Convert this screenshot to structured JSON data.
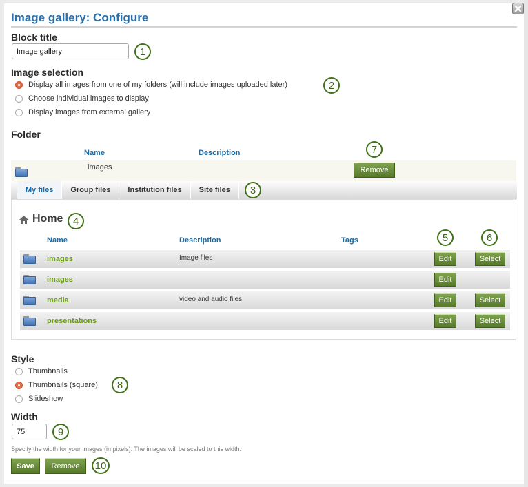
{
  "dialog": {
    "title": "Image gallery: Configure",
    "close_icon": "close-icon"
  },
  "block_title": {
    "label": "Block title",
    "value": "Image gallery"
  },
  "image_selection": {
    "label": "Image selection",
    "options": [
      {
        "label": "Display all images from one of my folders (will include images uploaded later)",
        "selected": true
      },
      {
        "label": "Choose individual images to display",
        "selected": false
      },
      {
        "label": "Display images from external gallery",
        "selected": false
      }
    ]
  },
  "folder": {
    "label": "Folder",
    "columns": {
      "name": "Name",
      "description": "Description"
    },
    "selected": {
      "icon": "folder-icon",
      "name": "images",
      "description": "",
      "remove_label": "Remove"
    }
  },
  "tabs": [
    {
      "label": "My files",
      "active": true
    },
    {
      "label": "Group files",
      "active": false
    },
    {
      "label": "Institution files",
      "active": false
    },
    {
      "label": "Site files",
      "active": false
    }
  ],
  "browser": {
    "home_icon": "home-icon",
    "home_label": "Home",
    "columns": {
      "name": "Name",
      "description": "Description",
      "tags": "Tags"
    },
    "rows": [
      {
        "name": "images",
        "description": "Image files",
        "edit": "Edit",
        "select": "Select"
      },
      {
        "name": "images",
        "description": "",
        "edit": "Edit",
        "select": ""
      },
      {
        "name": "media",
        "description": "video and audio files",
        "edit": "Edit",
        "select": "Select"
      },
      {
        "name": "presentations",
        "description": "",
        "edit": "Edit",
        "select": "Select"
      }
    ]
  },
  "style": {
    "label": "Style",
    "options": [
      {
        "label": "Thumbnails",
        "selected": false
      },
      {
        "label": "Thumbnails (square)",
        "selected": true
      },
      {
        "label": "Slideshow",
        "selected": false
      }
    ]
  },
  "width": {
    "label": "Width",
    "value": "75",
    "help": "Specify the width for your images (in pixels). The images will be scaled to this width."
  },
  "actions": {
    "save_label": "Save",
    "remove_label": "Remove"
  },
  "callouts": [
    "1",
    "2",
    "3",
    "4",
    "5",
    "6",
    "7",
    "8",
    "9",
    "10"
  ],
  "colors": {
    "accent": "#2a6eab",
    "button": "#5f842f",
    "radio_selected": "#ee6d44",
    "callout": "#41711a"
  }
}
